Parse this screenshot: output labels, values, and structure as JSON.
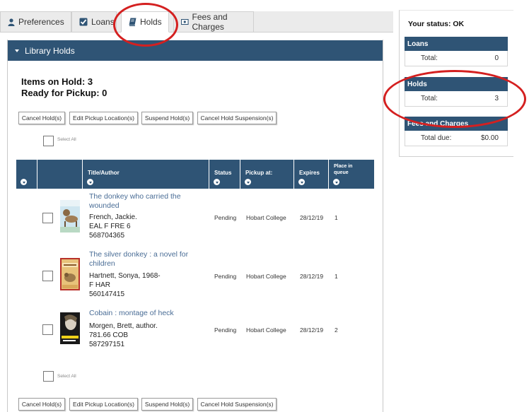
{
  "tabs": [
    {
      "label": "Preferences",
      "icon": "user-icon"
    },
    {
      "label": "Loans",
      "icon": "checkbox-icon"
    },
    {
      "label": "Holds",
      "icon": "book-icon",
      "active": true
    },
    {
      "label": "Fees and Charges",
      "icon": "money-icon"
    }
  ],
  "section": {
    "title": "Library Holds"
  },
  "summary": {
    "items_on_hold": "Items on Hold: 3",
    "ready_for_pickup": "Ready for Pickup: 0"
  },
  "actions": {
    "cancel": "Cancel Hold(s)",
    "edit_pickup": "Edit Pickup Location(s)",
    "suspend": "Suspend Hold(s)",
    "cancel_suspension": "Cancel Hold Suspension(s)"
  },
  "select_all_label": "Select All",
  "table": {
    "headers": {
      "title_author": "Title/Author",
      "status": "Status",
      "pickup_at": "Pickup at:",
      "expires": "Expires",
      "place_in_queue": "Place in queue"
    },
    "rows": [
      {
        "title_line1": "The donkey who carried the",
        "title_line2": "wounded",
        "author": "French, Jackie.",
        "call_number": "EAL F FRE 6",
        "barcode": "568704365",
        "status": "Pending",
        "pickup": "Hobart College",
        "expires": "28/12/19",
        "queue": "1"
      },
      {
        "title_line1": "The silver donkey : a novel for",
        "title_line2": "children",
        "author": "Hartnett, Sonya, 1968-",
        "call_number": "F HAR",
        "barcode": "560147415",
        "status": "Pending",
        "pickup": "Hobart College",
        "expires": "28/12/19",
        "queue": "1"
      },
      {
        "title_line1": "Cobain : montage of heck",
        "title_line2": "",
        "author": "Morgen, Brett, author.",
        "call_number": "781.66 COB",
        "barcode": "587297151",
        "status": "Pending",
        "pickup": "Hobart College",
        "expires": "28/12/19",
        "queue": "2"
      }
    ]
  },
  "status_panel": {
    "title": "Your status: OK",
    "loans": {
      "heading": "Loans",
      "label": "Total:",
      "value": "0"
    },
    "holds": {
      "heading": "Holds",
      "label": "Total:",
      "value": "3"
    },
    "fees": {
      "heading": "Fees and Charges",
      "label": "Total due:",
      "value": "$0.00"
    }
  },
  "colors": {
    "header_bg": "#2f5475",
    "link": "#4a6d96",
    "annotation": "#d42020"
  }
}
